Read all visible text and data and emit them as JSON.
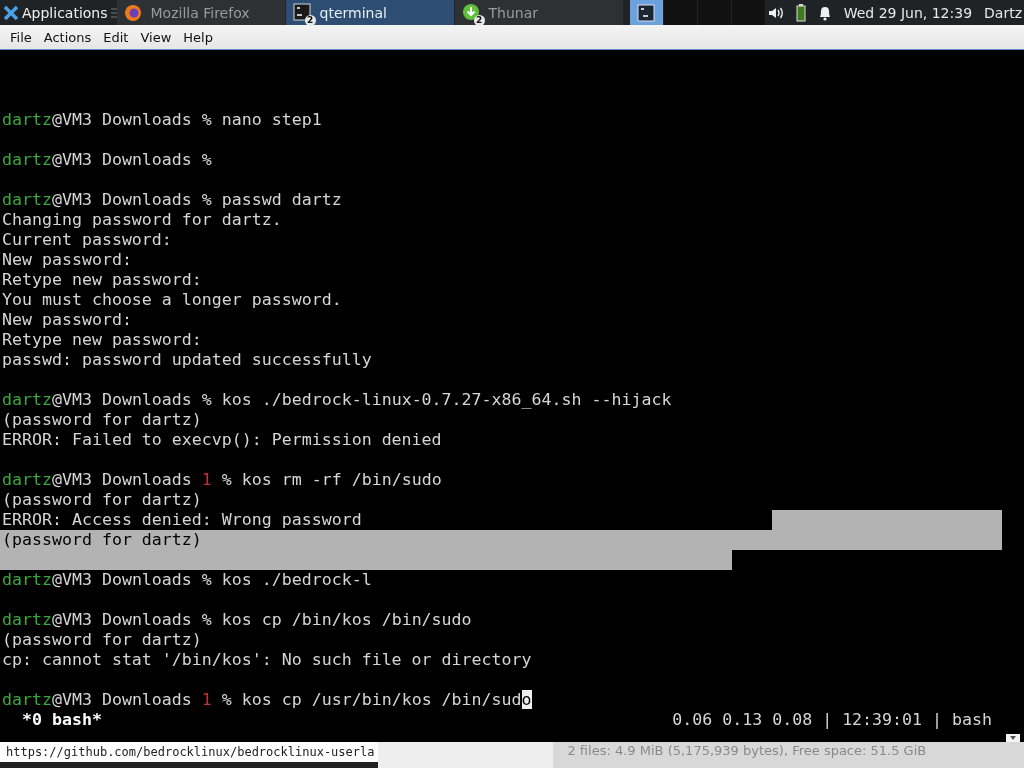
{
  "taskbar": {
    "menu_label": "Applications",
    "tasks": [
      {
        "kind": "firefox",
        "label": "Mozilla Firefox",
        "selected": false
      },
      {
        "kind": "terminal",
        "label": "qterminal",
        "badge": "2",
        "selected": true
      },
      {
        "kind": "files",
        "label": "Thunar",
        "badge": "2",
        "selected": false
      }
    ],
    "workspaces": [
      {
        "selected": true
      },
      {
        "selected": false
      },
      {
        "selected": false
      },
      {
        "selected": false
      }
    ],
    "clock": "Wed 29 Jun, 12:39",
    "user": "Dartz"
  },
  "menu_bar": [
    "File",
    "Actions",
    "Edit",
    "View",
    "Help"
  ],
  "terminal": {
    "lines": [
      {
        "kind": "blank"
      },
      {
        "kind": "blank"
      },
      {
        "kind": "blank"
      },
      {
        "kind": "prompt",
        "user": "dartz",
        "location": "@VM3 Downloads",
        "symbol": "%",
        "command": "nano step1"
      },
      {
        "kind": "blank"
      },
      {
        "kind": "prompt",
        "user": "dartz",
        "location": "@VM3 Downloads",
        "symbol": "%"
      },
      {
        "kind": "blank"
      },
      {
        "kind": "prompt",
        "user": "dartz",
        "location": "@VM3 Downloads",
        "symbol": "%",
        "command": "passwd dartz"
      },
      {
        "kind": "output",
        "text": "Changing password for dartz."
      },
      {
        "kind": "output",
        "text": "Current password:"
      },
      {
        "kind": "output",
        "text": "New password:"
      },
      {
        "kind": "output",
        "text": "Retype new password:"
      },
      {
        "kind": "output",
        "text": "You must choose a longer password."
      },
      {
        "kind": "output",
        "text": "New password:"
      },
      {
        "kind": "output",
        "text": "Retype new password:"
      },
      {
        "kind": "output",
        "text": "passwd: password updated successfully"
      },
      {
        "kind": "blank"
      },
      {
        "kind": "prompt",
        "user": "dartz",
        "location": "@VM3 Downloads",
        "symbol": "%",
        "command": "kos ./bedrock-linux-0.7.27-x86_64.sh --hijack"
      },
      {
        "kind": "output",
        "text": "(password for dartz)"
      },
      {
        "kind": "output",
        "text": "ERROR: Failed to execvp(): Permission denied"
      },
      {
        "kind": "blank"
      },
      {
        "kind": "prompt",
        "user": "dartz",
        "location": "@VM3 Downloads",
        "status": "1",
        "symbol": "%",
        "command": "kos rm -rf /bin/sudo"
      },
      {
        "kind": "output",
        "text": "(password for dartz)"
      },
      {
        "kind": "output",
        "text": "ERROR: Access denied: Wrong password",
        "selected": true
      },
      {
        "kind": "output",
        "text": "(password for dartz)",
        "selected": true
      },
      {
        "kind": "blank",
        "selected": true
      },
      {
        "kind": "prompt",
        "user": "dartz",
        "location": "@VM3 Downloads",
        "symbol": "%",
        "command": "kos ./bedrock-l"
      },
      {
        "kind": "blank"
      },
      {
        "kind": "prompt",
        "user": "dartz",
        "location": "@VM3 Downloads",
        "symbol": "%",
        "command": "kos cp /bin/kos /bin/sudo"
      },
      {
        "kind": "output",
        "text": "(password for dartz)"
      },
      {
        "kind": "output",
        "text": "cp: cannot stat '/bin/kos': No such file or directory"
      },
      {
        "kind": "blank"
      },
      {
        "kind": "prompt",
        "user": "dartz",
        "location": "@VM3 Downloads",
        "status": "1",
        "symbol": "%",
        "command": "kos cp /usr/bin/kos /bin/sud",
        "cursor": "o"
      }
    ],
    "status_line": {
      "window": "*0 bash*",
      "info": "0.06 0.13 0.08 | 12:39:01 | bash"
    }
  },
  "background_window": {
    "path_text": "https://github.com/bedrocklinux/bedrocklinux-userla",
    "status_bar": "2 files: 4.9 MiB (5,175,939 bytes), Free space: 51.5 GiB"
  }
}
